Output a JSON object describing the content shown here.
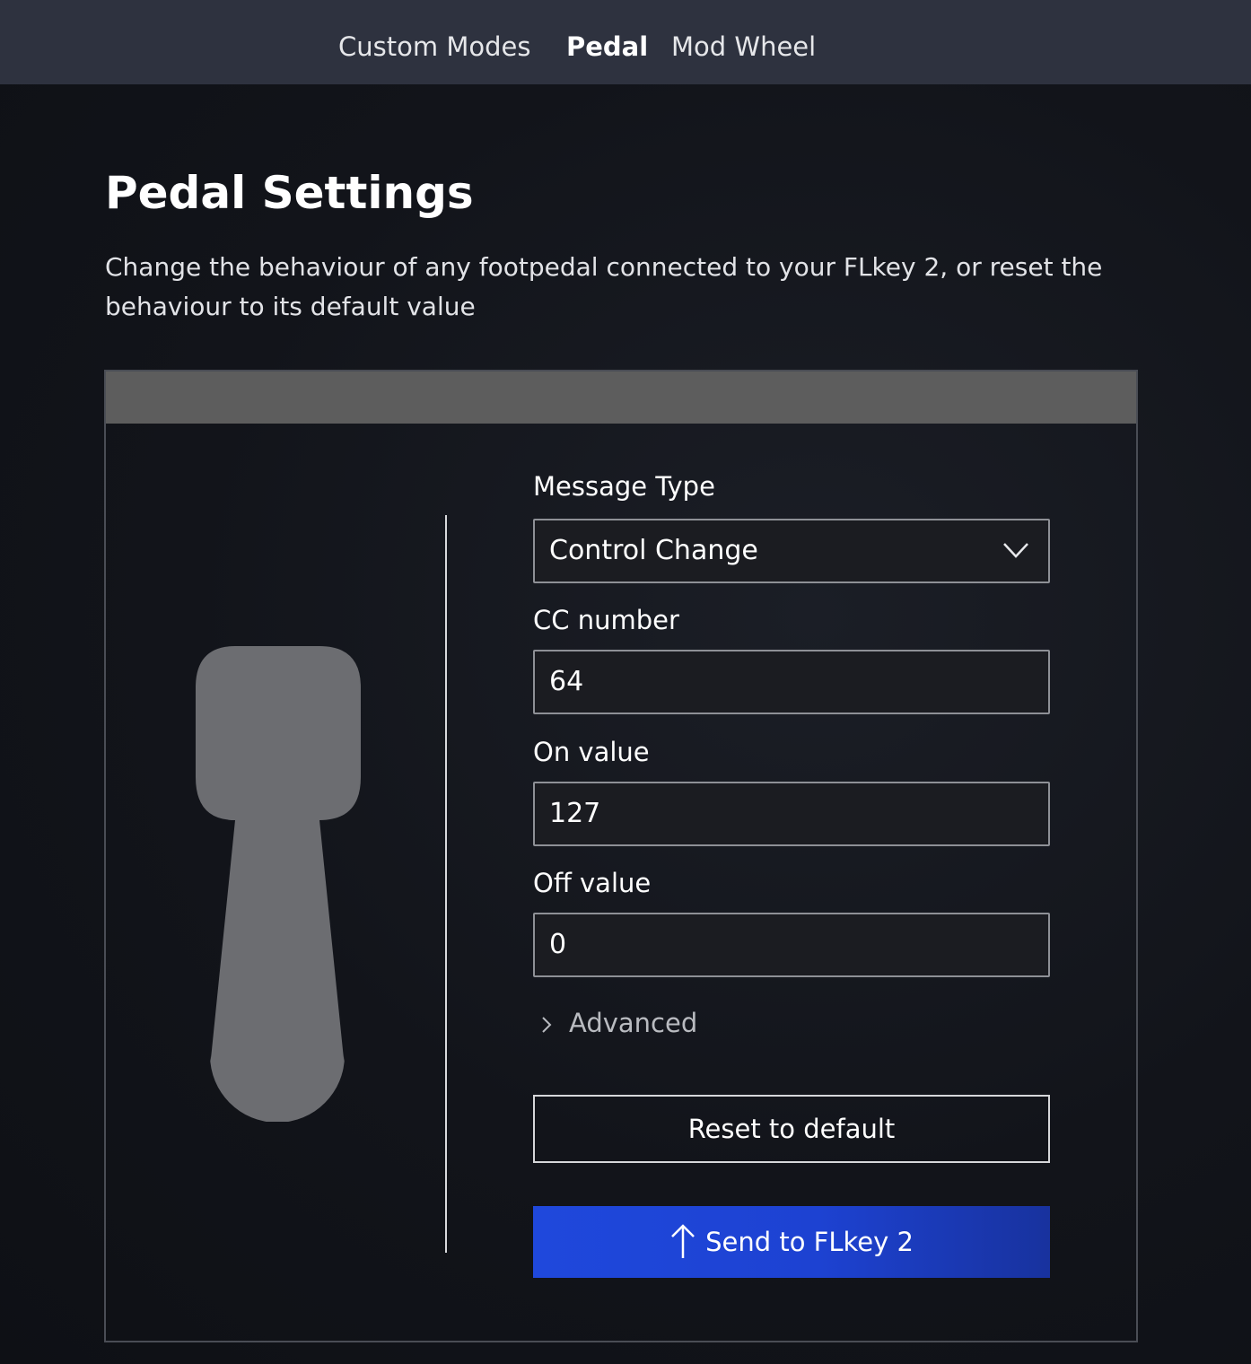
{
  "nav": {
    "tabs": [
      {
        "label": "Custom Modes",
        "active": false
      },
      {
        "label": "Pedal",
        "active": true
      },
      {
        "label": "Mod Wheel",
        "active": false
      }
    ]
  },
  "page": {
    "title": "Pedal Settings",
    "description": "Change the behaviour of any footpedal connected to your FLkey 2, or reset the behaviour to its default value"
  },
  "form": {
    "message_type": {
      "label": "Message Type",
      "value": "Control Change",
      "icon": "chevron-down-icon"
    },
    "cc_number": {
      "label": "CC number",
      "value": "64"
    },
    "on_value": {
      "label": "On value",
      "value": "127"
    },
    "off_value": {
      "label": "Off value",
      "value": "0"
    },
    "advanced": {
      "label": "Advanced",
      "icon": "chevron-right-icon"
    },
    "reset_label": "Reset to default",
    "send_label": "Send to FLkey 2",
    "send_icon": "arrow-up-icon"
  },
  "colors": {
    "nav_background": "#2e323f",
    "panel_header": "#5d5d5d",
    "pedal_fill": "#6c6d71",
    "send_button": "#1f48dc"
  }
}
